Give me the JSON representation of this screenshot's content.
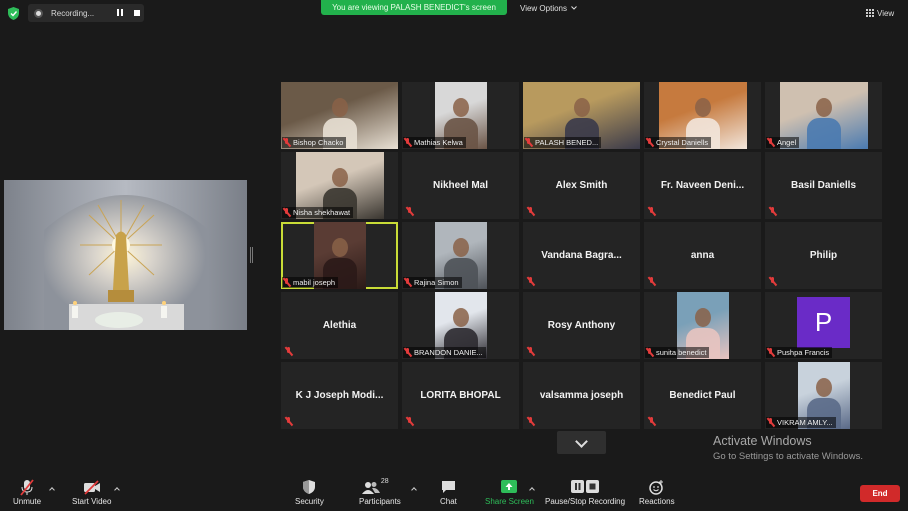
{
  "topbar": {
    "recording_label": "Recording...",
    "banner_text": "You are viewing PALASH BENEDICT's screen",
    "view_options_label": "View Options",
    "view_label": "View"
  },
  "participants": [
    {
      "name": "Bishop Chacko",
      "video": true
    },
    {
      "name": "Mathias Kelwa",
      "video": true
    },
    {
      "name": "PALASH BENED...",
      "video": true
    },
    {
      "name": "Crystal Daniells",
      "video": true
    },
    {
      "name": "Angel",
      "video": true
    },
    {
      "name": "Nisha shekhawat",
      "video": true
    },
    {
      "name": "Nikheel Mal",
      "video": false
    },
    {
      "name": "Alex Smith",
      "video": false
    },
    {
      "name": "Fr. Naveen Deni...",
      "video": false
    },
    {
      "name": "Basil Daniells",
      "video": false
    },
    {
      "name": "mabil joseph",
      "video": true
    },
    {
      "name": "Rajina Simon",
      "video": true
    },
    {
      "name": "Vandana  Bagra...",
      "video": false
    },
    {
      "name": "anna",
      "video": false
    },
    {
      "name": "Philip",
      "video": false
    },
    {
      "name": "Alethia",
      "video": false
    },
    {
      "name": "BRANDON DANIE...",
      "video": true
    },
    {
      "name": "Rosy Anthony",
      "video": false
    },
    {
      "name": "sunita benedict",
      "video": true
    },
    {
      "name": "Pushpa Francis",
      "video": false,
      "avatar_letter": "P",
      "avatar_color": "#6a2bc7"
    },
    {
      "name": "K J Joseph Modi...",
      "video": false
    },
    {
      "name": "LORITA BHOPAL",
      "video": false
    },
    {
      "name": "valsamma joseph",
      "video": false
    },
    {
      "name": "Benedict Paul",
      "video": false
    },
    {
      "name": "VIKRAM AMLY...",
      "video": true
    }
  ],
  "watermark": {
    "line1": "Activate Windows",
    "line2": "Go to Settings to activate Windows."
  },
  "toolbar": {
    "unmute": "Unmute",
    "start_video": "Start Video",
    "security": "Security",
    "participants": "Participants",
    "participants_count": "28",
    "chat": "Chat",
    "share_screen": "Share Screen",
    "pause_recording": "Pause/Stop Recording",
    "reactions": "Reactions",
    "end": "End"
  },
  "colors": {
    "banner_green": "#22b14c",
    "active_speaker": "#c9dc37",
    "end_red": "#d12a2a",
    "muted_red": "#e23b3b"
  }
}
